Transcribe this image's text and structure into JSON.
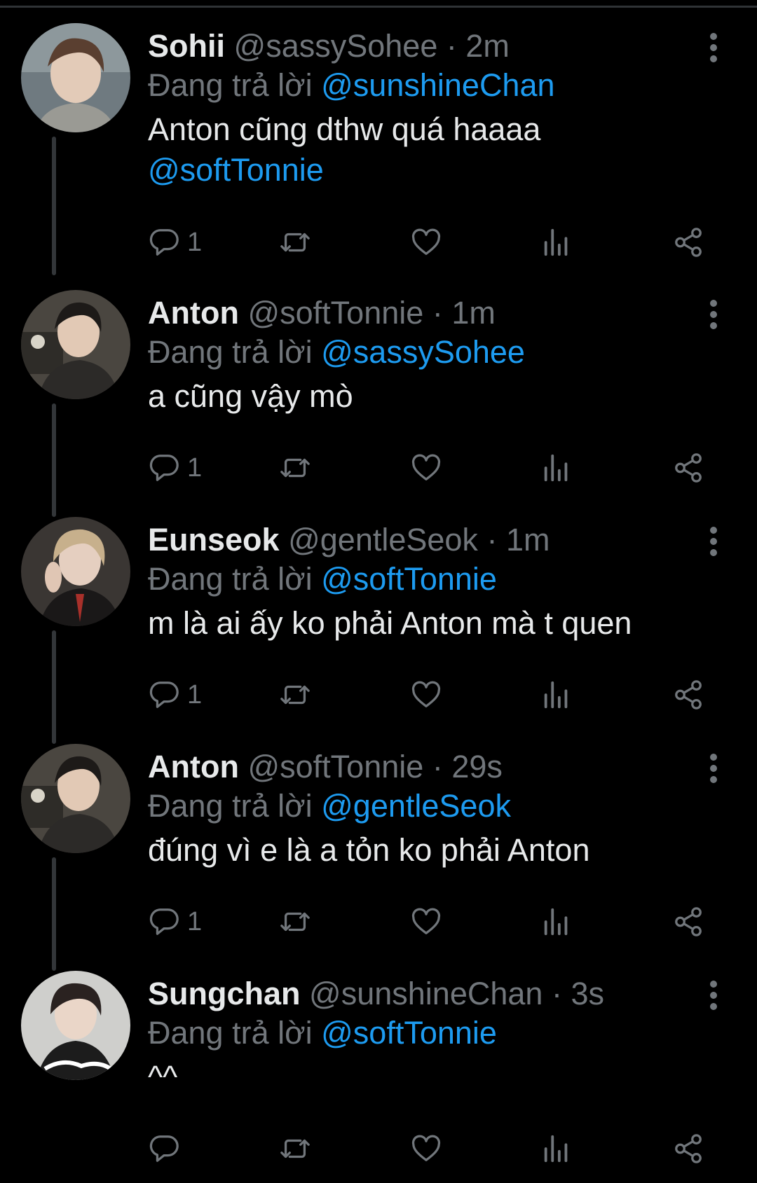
{
  "thread": {
    "tweets": [
      {
        "name": "Sohii",
        "handle": "@sassySohee",
        "separator": "·",
        "time": "2m",
        "reply_prefix": "Đang trả lời",
        "reply_to": "@sunshineChan",
        "text_line1": "Anton cũng dthw quá haaaa",
        "text_mention": "@softTonnie",
        "reply_count": "1",
        "avatar_icon": "avatar-photo"
      },
      {
        "name": "Anton",
        "handle": "@softTonnie",
        "separator": "·",
        "time": "1m",
        "reply_prefix": "Đang trả lời",
        "reply_to": "@sassySohee",
        "text_line1": "a cũng vậy mò",
        "reply_count": "1",
        "avatar_icon": "avatar-photo"
      },
      {
        "name": "Eunseok",
        "handle": "@gentleSeok",
        "separator": "·",
        "time": "1m",
        "reply_prefix": "Đang trả lời",
        "reply_to": "@softTonnie",
        "text_line1": "m là ai ấy ko phải Anton mà t quen",
        "reply_count": "1",
        "avatar_icon": "avatar-photo"
      },
      {
        "name": "Anton",
        "handle": "@softTonnie",
        "separator": "·",
        "time": "29s",
        "reply_prefix": "Đang trả lời",
        "reply_to": "@gentleSeok",
        "text_line1": "đúng vì e là a tỏn ko phải Anton",
        "reply_count": "1",
        "avatar_icon": "avatar-photo"
      },
      {
        "name": "Sungchan",
        "handle": "@sunshineChan",
        "separator": "·",
        "time": "3s",
        "reply_prefix": "Đang trả lời",
        "reply_to": "@softTonnie",
        "text_line1": "^^",
        "reply_count": "",
        "avatar_icon": "avatar-photo"
      }
    ]
  },
  "icons": {
    "reply": "reply-icon",
    "retweet": "retweet-icon",
    "like": "heart-icon",
    "views": "views-icon",
    "share": "share-icon",
    "more": "more-vertical-icon"
  },
  "colors": {
    "background": "#000000",
    "text": "#e7e9ea",
    "secondary": "#71767b",
    "mention": "#1d9bf0",
    "connector": "#333639"
  }
}
